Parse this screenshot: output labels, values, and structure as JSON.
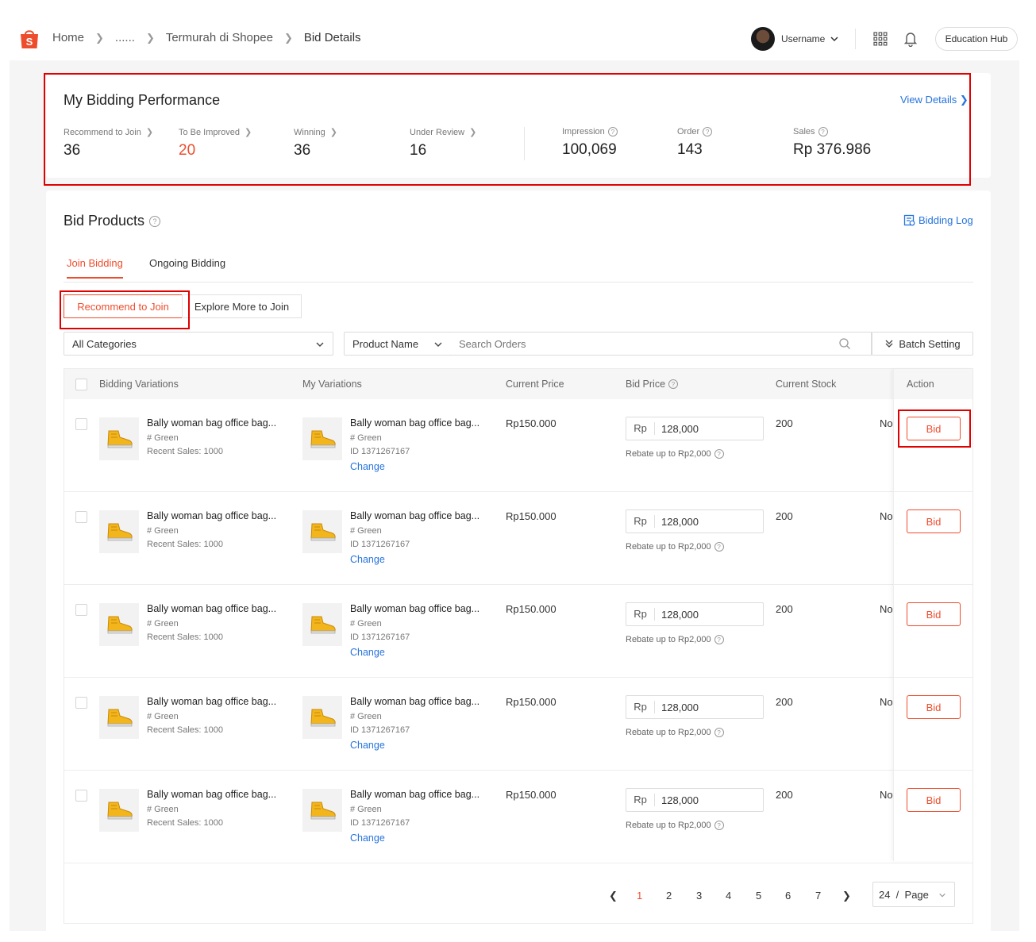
{
  "breadcrumb": [
    "Home",
    "......",
    "Termurah di Shopee",
    "Bid Details"
  ],
  "user": {
    "name": "Username"
  },
  "header": {
    "education_hub": "Education Hub"
  },
  "performance": {
    "title": "My Bidding Performance",
    "view_details": "View Details",
    "metrics": [
      {
        "label": "Recommend to Join",
        "value": "36"
      },
      {
        "label": "To Be Improved",
        "value": "20"
      },
      {
        "label": "Winning",
        "value": "36"
      },
      {
        "label": "Under Review",
        "value": "16"
      },
      {
        "label": "Impression",
        "value": "100,069"
      },
      {
        "label": "Order",
        "value": "143"
      },
      {
        "label": "Sales",
        "value": "Rp 376.986"
      }
    ]
  },
  "products": {
    "title": "Bid Products",
    "bidding_log": "Bidding Log",
    "tabs": [
      "Join Bidding",
      "Ongoing Bidding"
    ],
    "subtabs": [
      "Recommend to Join",
      "Explore More to Join"
    ],
    "category_filter": "All Categories",
    "search_by": "Product Name",
    "search_placeholder": "Search Orders",
    "batch_setting": "Batch Setting",
    "columns": [
      "Bidding Variations",
      "My Variations",
      "Current Price",
      "Bid Price",
      "Current Stock",
      "Action"
    ],
    "rows": [
      {
        "bid_name": "Bally woman bag office bag...",
        "bid_variant": "# Green",
        "recent_sales": "Recent Sales: 1000",
        "my_name": "Bally woman bag office bag...",
        "my_variant": "# Green",
        "my_id": "ID 1371267167",
        "change": "Change",
        "current_price": "Rp150.000",
        "currency": "Rp",
        "bid_price": "128,000",
        "rebate": "Rebate up to Rp2,000",
        "stock": "200",
        "extra": "No",
        "action": "Bid"
      },
      {
        "bid_name": "Bally woman bag office bag...",
        "bid_variant": "# Green",
        "recent_sales": "Recent Sales: 1000",
        "my_name": "Bally woman bag office bag...",
        "my_variant": "# Green",
        "my_id": "ID 1371267167",
        "change": "Change",
        "current_price": "Rp150.000",
        "currency": "Rp",
        "bid_price": "128,000",
        "rebate": "Rebate up to Rp2,000",
        "stock": "200",
        "extra": "No",
        "action": "Bid"
      },
      {
        "bid_name": "Bally woman bag office bag...",
        "bid_variant": "# Green",
        "recent_sales": "Recent Sales: 1000",
        "my_name": "Bally woman bag office bag...",
        "my_variant": "# Green",
        "my_id": "ID 1371267167",
        "change": "Change",
        "current_price": "Rp150.000",
        "currency": "Rp",
        "bid_price": "128,000",
        "rebate": "Rebate up to Rp2,000",
        "stock": "200",
        "extra": "No",
        "action": "Bid"
      },
      {
        "bid_name": "Bally woman bag office bag...",
        "bid_variant": "# Green",
        "recent_sales": "Recent Sales: 1000",
        "my_name": "Bally woman bag office bag...",
        "my_variant": "# Green",
        "my_id": "ID 1371267167",
        "change": "Change",
        "current_price": "Rp150.000",
        "currency": "Rp",
        "bid_price": "128,000",
        "rebate": "Rebate up to Rp2,000",
        "stock": "200",
        "extra": "No",
        "action": "Bid"
      },
      {
        "bid_name": "Bally woman bag office bag...",
        "bid_variant": "# Green",
        "recent_sales": "Recent Sales: 1000",
        "my_name": "Bally woman bag office bag...",
        "my_variant": "# Green",
        "my_id": "ID 1371267167",
        "change": "Change",
        "current_price": "Rp150.000",
        "currency": "Rp",
        "bid_price": "128,000",
        "rebate": "Rebate up to Rp2,000",
        "stock": "200",
        "extra": "No",
        "action": "Bid"
      }
    ],
    "pagination": {
      "pages": [
        "1",
        "2",
        "3",
        "4",
        "5",
        "6",
        "7"
      ],
      "current": "1",
      "per_page": "24  /  Page"
    }
  },
  "colors": {
    "brand": "#ee4d2d",
    "link": "#2673dd",
    "annotation": "#e00000"
  }
}
